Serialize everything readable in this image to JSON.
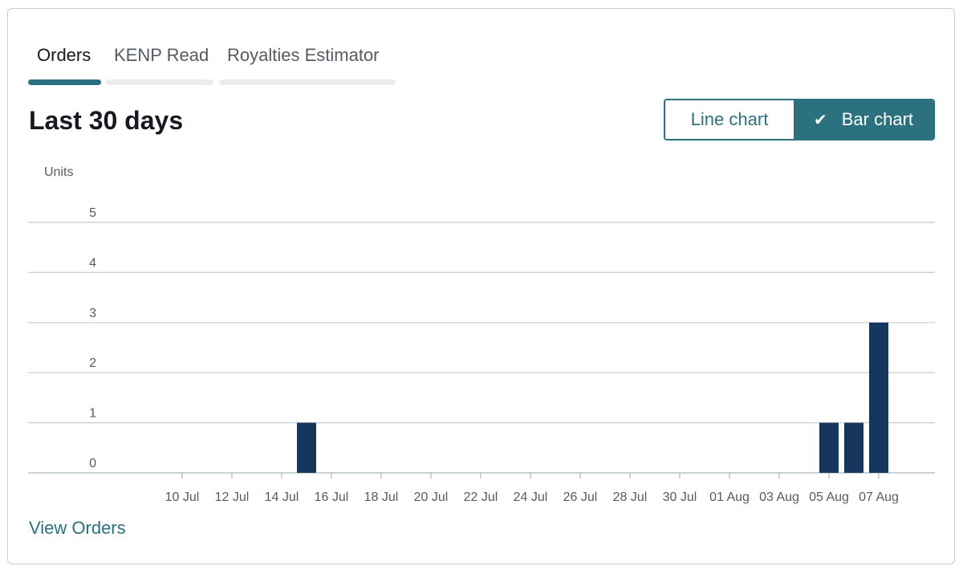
{
  "tabs": [
    {
      "label": "Orders",
      "active": true
    },
    {
      "label": "KENP Read",
      "active": false
    },
    {
      "label": "Royalties Estimator",
      "active": false
    }
  ],
  "page_title": "Last 30 days",
  "chart_toggle": {
    "line_label": "Line chart",
    "bar_label": "Bar chart",
    "selected": "bar",
    "check_icon": "check-icon"
  },
  "colors": {
    "accent": "#2b7180",
    "bar": "#15375e",
    "grid": "#c8ccd1"
  },
  "chart_data": {
    "type": "bar",
    "ylabel": "Units",
    "xlabel": "",
    "title": "",
    "ylim": [
      0,
      5
    ],
    "yticks": [
      0,
      1,
      2,
      3,
      4,
      5
    ],
    "grid": true,
    "categories": [
      "08 Jul",
      "09 Jul",
      "10 Jul",
      "11 Jul",
      "12 Jul",
      "13 Jul",
      "14 Jul",
      "15 Jul",
      "16 Jul",
      "17 Jul",
      "18 Jul",
      "19 Jul",
      "20 Jul",
      "21 Jul",
      "22 Jul",
      "23 Jul",
      "24 Jul",
      "25 Jul",
      "26 Jul",
      "27 Jul",
      "28 Jul",
      "29 Jul",
      "30 Jul",
      "31 Jul",
      "01 Aug",
      "02 Aug",
      "03 Aug",
      "04 Aug",
      "05 Aug",
      "06 Aug",
      "07 Aug",
      "08 Aug"
    ],
    "tick_labels": [
      "10 Jul",
      "12 Jul",
      "14 Jul",
      "16 Jul",
      "18 Jul",
      "20 Jul",
      "22 Jul",
      "24 Jul",
      "26 Jul",
      "28 Jul",
      "30 Jul",
      "01 Aug",
      "03 Aug",
      "05 Aug",
      "07 Aug"
    ],
    "values": [
      0,
      0,
      0,
      0,
      0,
      0,
      0,
      1,
      0,
      0,
      0,
      0,
      0,
      0,
      0,
      0,
      0,
      0,
      0,
      0,
      0,
      0,
      0,
      0,
      0,
      0,
      0,
      0,
      1,
      1,
      3,
      0
    ]
  },
  "footer": {
    "view_orders_label": "View Orders"
  }
}
